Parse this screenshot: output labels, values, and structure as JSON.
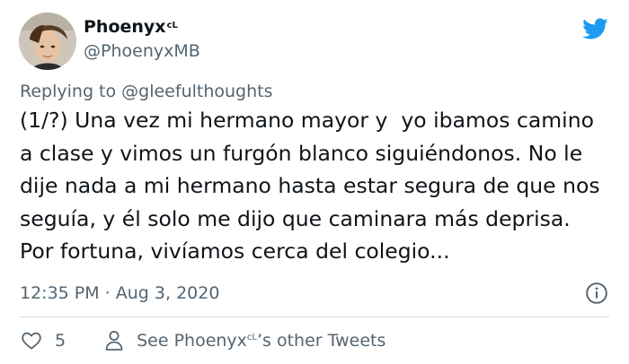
{
  "user": {
    "display_name": "Phoenyx",
    "display_name_suffix": "cL",
    "handle": "@PhoenyxMB",
    "avatar_icon": "profile-photo"
  },
  "reply": {
    "prefix": "Replying to ",
    "target": "@gleefulthoughts"
  },
  "tweet": {
    "lines": [
      "(1/?) Una vez mi hermano mayor y  yo ibamos camino",
      "a clase y vimos un furgón blanco siguiéndonos. No le",
      "dije nada a mi hermano hasta estar segura de que nos",
      "seguía, y él solo me dijo que caminara más deprisa.",
      "Por fortuna, vivíamos cerca del colegio..."
    ],
    "timestamp": "12:35 PM · Aug 3, 2020"
  },
  "actions": {
    "like_count": "5",
    "see_more_prefix": "See Phoenyx",
    "see_more_suffix_sup": "cL",
    "see_more_tail": "’s other Tweets"
  },
  "colors": {
    "twitter_blue": "#1d9bf0",
    "text_primary": "#0f1419",
    "text_secondary": "#536471",
    "divider": "#cfd9de"
  },
  "icons": {
    "brand": "twitter-bird-icon",
    "info": "info-icon",
    "like": "heart-icon",
    "profile": "person-icon"
  }
}
